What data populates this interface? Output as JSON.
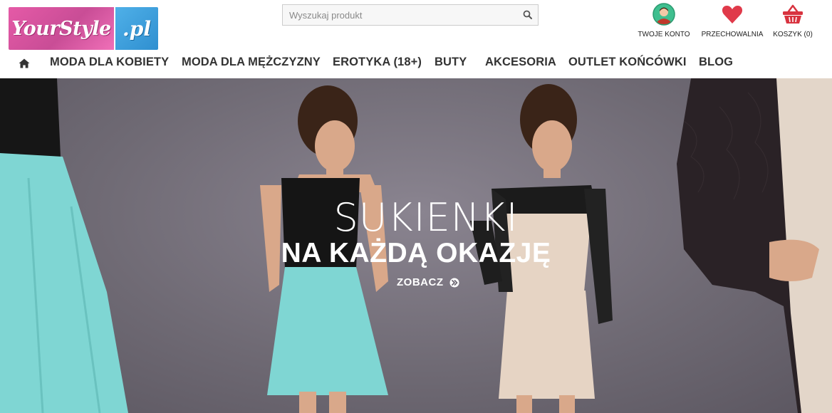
{
  "logo": {
    "part1": "YourStyle",
    "part2": ".pl"
  },
  "search": {
    "placeholder": "Wyszukaj produkt"
  },
  "header_icons": [
    {
      "label": "TWOJE KONTO",
      "icon": "user-avatar-icon"
    },
    {
      "label": "PRZECHOWALNIA",
      "icon": "heart-icon"
    },
    {
      "label": "KOSZYK (0)",
      "icon": "basket-icon"
    }
  ],
  "nav": {
    "home_icon": "home-icon",
    "items": [
      {
        "label": "MODA DLA KOBIETY"
      },
      {
        "label": "MODA DLA MĘŻCZYZNY"
      },
      {
        "label": "EROTYKA (18+)"
      },
      {
        "label": "BUTY"
      },
      {
        "label": "AKCESORIA"
      },
      {
        "label": "OUTLET KOŃCÓWKI"
      },
      {
        "label": "BLOG"
      }
    ]
  },
  "hero": {
    "title": "SUKIENKI",
    "subtitle": "NA KAŻDĄ OKAZJĘ",
    "cta": "ZOBACZ",
    "cta_icon": "double-chevron-right-icon"
  },
  "colors": {
    "logo_pink": "#e55aa7",
    "logo_blue": "#3a9ddc",
    "heart_red": "#e03a4a",
    "basket_red": "#d8333f",
    "avatar_green": "#3fbf8f",
    "nav_text": "#333333",
    "hero_bg": "#6f6a74"
  }
}
